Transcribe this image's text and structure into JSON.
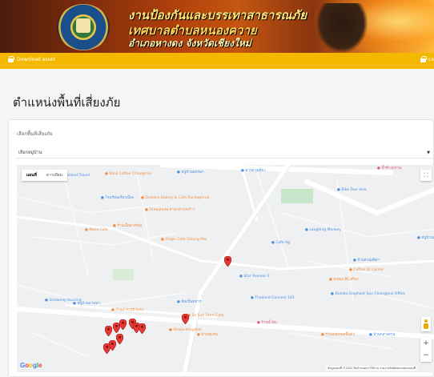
{
  "banner": {
    "line1": "งานป้องกันและบรรเทาสาธารณภัย",
    "line2": "เทศบาลตำบลหนองควาย",
    "line3": "อำเภอหางดง จังหวัดเชียงใหม่",
    "emblem_text": "เทศบาลตำบลหนองควาย"
  },
  "nav": {
    "left_label": "Download asset",
    "right_label": "Lo"
  },
  "page_title": "ตำแหน่งพื้นที่เสี่ยงภัย",
  "filter": {
    "label": "เลือกพื้นที่เสี่ยงภัย",
    "selected": "เลือกหมู่บ้าน"
  },
  "map": {
    "type_map": "แผนที่",
    "type_satellite": "ดาวเทียม",
    "zoom_in": "+",
    "zoom_out": "−",
    "fullscreen": "⛶",
    "attribution": "ข้อมูลแผนที่ ©2022  ข้อกำหนดการใช้งาน  รายงานข้อผิดพลาดของแผนที่",
    "google": "Google",
    "colors": {
      "marker": "#e53935",
      "road_main": "#ffffff",
      "water": "#aadaff",
      "park": "#c8e6c9",
      "poi_orange": "#f28b3a",
      "poi_blue": "#4a8de0",
      "poi_pink": "#e8578a"
    },
    "places": [
      {
        "name": "Kanji Coffee Chiangmai",
        "kind": "poi_orange"
      },
      {
        "name": "หมู่บ้านพฤกษา",
        "kind": "poi_blue"
      },
      {
        "name": "ดาวดวงเดียว",
        "kind": "poi_blue"
      },
      {
        "name": "บิ๊กซีวงแหวน",
        "kind": "poi_pink"
      },
      {
        "name": "Bike Tour Asia",
        "kind": "poi_blue"
      },
      {
        "name": "Chiang Mai & North Thailand Travel",
        "kind": "poi_blue"
      },
      {
        "name": "Dolsava Bakery & Cafe Ruchaphruk",
        "kind": "poi_orange"
      },
      {
        "name": "โกลบเลมอน สาขาท่าวังพร้าว",
        "kind": "poi_orange"
      },
      {
        "name": "โรงเรียนเกี่ยวเนื่อง",
        "kind": "poi_blue"
      },
      {
        "name": "Nano Cafe",
        "kind": "poi_orange"
      },
      {
        "name": "ร้านเนื้อย่างร้อน",
        "kind": "poi_orange"
      },
      {
        "name": "Laughing Monkey",
        "kind": "poi_blue"
      },
      {
        "name": "Origin Cafe Chiang Mai",
        "kind": "poi_orange"
      },
      {
        "name": "Cafe Ag",
        "kind": "poi_blue"
      },
      {
        "name": "หมู่บ้านเวียงพิงค์ 12",
        "kind": "poi_blue"
      },
      {
        "name": "บ้านสวนลลิตา",
        "kind": "poi_blue"
      },
      {
        "name": "Coffee Dr Center",
        "kind": "poi_orange"
      },
      {
        "name": "Star Avenue 3",
        "kind": "poi_blue"
      },
      {
        "name": "ดอนมะลิCoffee",
        "kind": "poi_orange"
      },
      {
        "name": "Thailand Connect 101",
        "kind": "poi_blue"
      },
      {
        "name": "Dumbo Elephant Spa Chiangmai Office",
        "kind": "poi_blue"
      },
      {
        "name": "Sinsaeng Housing",
        "kind": "poi_blue"
      },
      {
        "name": "หมู่บ้านลานนา",
        "kind": "poi_blue"
      },
      {
        "name": "ห้องปั้นทหาร",
        "kind": "poi_blue"
      },
      {
        "name": "Shabu-Kingdom",
        "kind": "poi_orange"
      },
      {
        "name": "Bo Sub Farm Cafe",
        "kind": "poi_orange"
      },
      {
        "name": "บ้านชุมชน",
        "kind": "poi_orange"
      },
      {
        "name": "ร้านอาหารป้าแดง",
        "kind": "poi_orange"
      },
      {
        "name": "ร้านน้ำส้ม",
        "kind": "poi_pink"
      },
      {
        "name": "ร้านหอยทอดขึ้นตัว",
        "kind": "poi_orange"
      },
      {
        "name": "บ้านกลางสวน",
        "kind": "poi_blue"
      }
    ],
    "markers": [
      {
        "label": "จุดเสี่ยงภัย 1"
      },
      {
        "label": "จุดเสี่ยงภัย 2"
      },
      {
        "label": "จุดเสี่ยงภัย 3"
      },
      {
        "label": "จุดเสี่ยงภัย 4"
      },
      {
        "label": "จุดเสี่ยงภัย 5"
      },
      {
        "label": "จุดเสี่ยงภัย 6"
      },
      {
        "label": "จุดเสี่ยงภัย 7"
      },
      {
        "label": "จุดเสี่ยงภัย 8"
      },
      {
        "label": "จุดเสี่ยงภัย 9"
      },
      {
        "label": "จุดเสี่ยงภัย 10"
      },
      {
        "label": "จุดเสี่ยงภัย 11"
      }
    ]
  }
}
